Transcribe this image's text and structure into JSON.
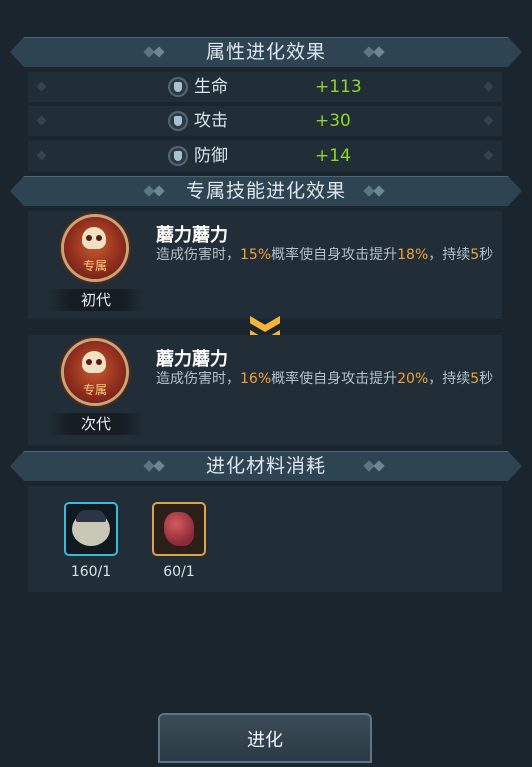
{
  "sections": {
    "attributes_title": "属性进化效果",
    "skill_title": "专属技能进化效果",
    "materials_title": "进化材料消耗"
  },
  "attributes": [
    {
      "icon": "heart-shield-icon",
      "label": "生命",
      "value": "+113"
    },
    {
      "icon": "sword-shield-icon",
      "label": "攻击",
      "value": "+30"
    },
    {
      "icon": "armor-shield-icon",
      "label": "防御",
      "value": "+14"
    }
  ],
  "skills": [
    {
      "emblem_tag": "专属",
      "generation": "初代",
      "name": "蘑力蘑力",
      "desc_1": "造成伤害时，",
      "pct_1": "15%",
      "desc_2": "概率使自身攻击提升",
      "pct_2": "18%",
      "desc_3": "，持续",
      "duration": "5",
      "desc_4": "秒"
    },
    {
      "emblem_tag": "专属",
      "generation": "次代",
      "name": "蘑力蘑力",
      "desc_1": "造成伤害时，",
      "pct_1": "16%",
      "desc_2": "概率使自身攻击提升",
      "pct_2": "20%",
      "desc_3": "，持续",
      "duration": "5",
      "desc_4": "秒"
    }
  ],
  "materials": [
    {
      "icon": "mushroom-hero-icon",
      "count": "160/1",
      "frame_color": "#3fb9d7"
    },
    {
      "icon": "red-crystal-icon",
      "count": "60/1",
      "frame_color": "#d7a54c"
    }
  ],
  "evolve_button": "进化",
  "colors": {
    "positive": "#8fd62b",
    "highlight": "#f0a23a",
    "arrow": "#f3b43a"
  }
}
